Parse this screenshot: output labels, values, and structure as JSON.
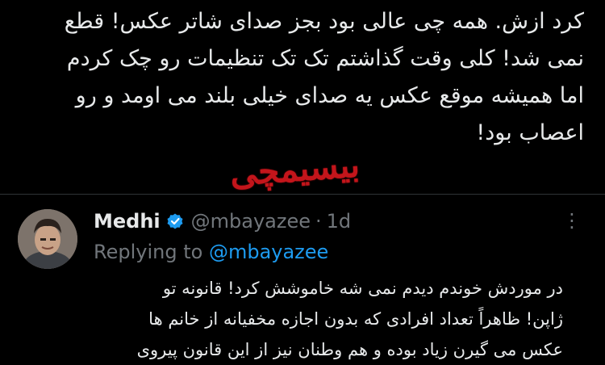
{
  "original_tweet": {
    "text": "کرد ازش. همه چی عالی بود بجز صدای شاتر عکس! قطع\nنمی شد! کلی وقت گذاشتم تک تک تنظیمات رو چک کردم\nاما همیشه موقع عکس یه صدای خیلی بلند می اومد و رو\nاعصاب بود!"
  },
  "watermark": {
    "text": "بیسیمچی",
    "color": "#c3151b"
  },
  "reply": {
    "author_name": "Medhi",
    "verified_icon": "verified-badge-icon",
    "handle": "@mbayazee",
    "separator": "·",
    "time": "1d",
    "more_icon": "more-options-icon",
    "replying_prefix": "Replying to",
    "replying_to": "@mbayazee",
    "text": "در موردش خوندم دیدم نمی شه خاموشش کرد! قانونه تو\nژاپن! ظاهراً تعداد افرادی که بدون اجازه مخفیانه از خانم ها\nعکس می گیرن زیاد بوده و هم وطنان نیز از این قانون پیروی"
  },
  "colors": {
    "background": "#000000",
    "text": "#e7e9ea",
    "muted": "#71767b",
    "accent": "#1d9bf0",
    "divider": "#2f3336"
  }
}
